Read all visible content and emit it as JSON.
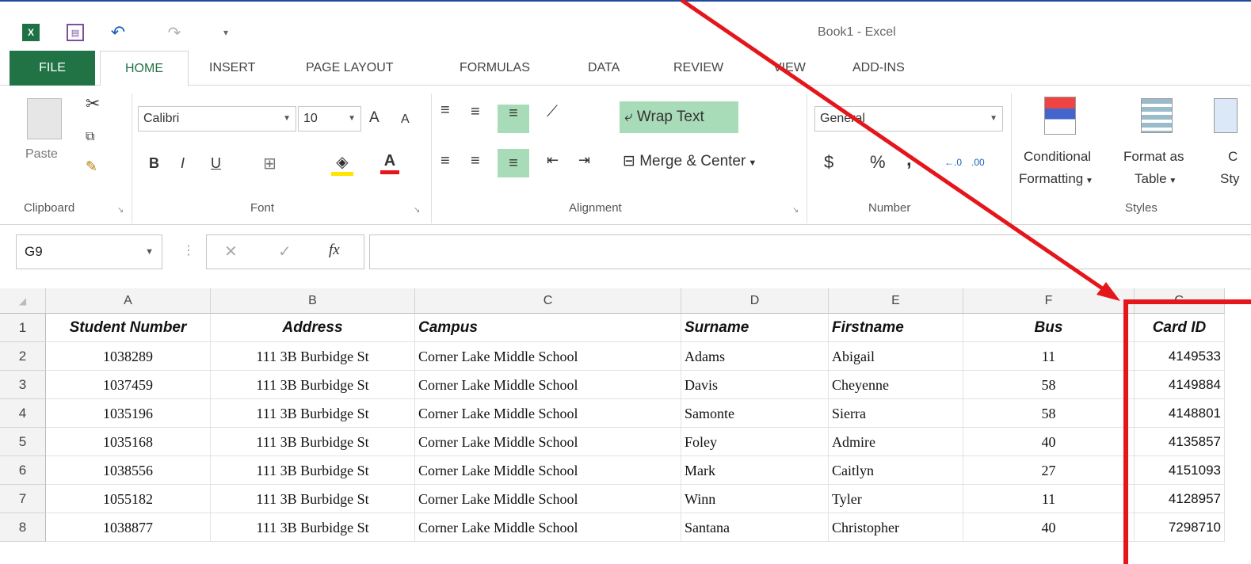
{
  "window": {
    "title": "Book1 - Excel"
  },
  "qat": {
    "logo": "X",
    "undo": "↶",
    "redo": "↷",
    "more": "▾"
  },
  "tabs": [
    "FILE",
    "HOME",
    "INSERT",
    "PAGE LAYOUT",
    "FORMULAS",
    "DATA",
    "REVIEW",
    "VIEW",
    "ADD-INS"
  ],
  "ribbon": {
    "clipboard": {
      "paste": "Paste",
      "label": "Clipboard"
    },
    "font": {
      "name": "Calibri",
      "size": "10",
      "bold": "B",
      "italic": "I",
      "underline": "U",
      "grow": "A",
      "shrink": "A",
      "fontcolor": "A",
      "label": "Font"
    },
    "alignment": {
      "wrap": "Wrap Text",
      "merge": "Merge & Center",
      "label": "Alignment"
    },
    "number": {
      "format": "General",
      "currency": "$",
      "percent": "%",
      "comma": ",",
      "label": "Number",
      "inc_dec": "←.0",
      "dec_dec": ".00"
    },
    "styles": {
      "cond1": "Conditional",
      "cond2": "Formatting",
      "fmt1": "Format as",
      "fmt2": "Table",
      "cell1": "C",
      "cell2": "Sty",
      "label": "Styles"
    }
  },
  "formula_bar": {
    "name_box": "G9",
    "fx": "fx",
    "cancel": "✕",
    "enter": "✓",
    "value": ""
  },
  "columns": [
    "A",
    "B",
    "C",
    "D",
    "E",
    "F",
    "G"
  ],
  "rows": [
    {
      "n": "1",
      "A": "Student Number",
      "B": "Address",
      "C": "Campus",
      "D": "Surname",
      "E": "Firstname",
      "F": "Bus",
      "G": "Card ID"
    },
    {
      "n": "2",
      "A": "1038289",
      "B": "111 3B Burbidge St",
      "C": "Corner Lake Middle School",
      "D": "Adams",
      "E": "Abigail",
      "F": "11",
      "G": "4149533"
    },
    {
      "n": "3",
      "A": "1037459",
      "B": "111 3B Burbidge St",
      "C": "Corner Lake Middle School",
      "D": "Davis",
      "E": "Cheyenne",
      "F": "58",
      "G": "4149884"
    },
    {
      "n": "4",
      "A": "1035196",
      "B": "111 3B Burbidge St",
      "C": "Corner Lake Middle School",
      "D": "Samonte",
      "E": "Sierra",
      "F": "58",
      "G": "4148801"
    },
    {
      "n": "5",
      "A": "1035168",
      "B": "111 3B Burbidge St",
      "C": "Corner Lake Middle School",
      "D": "Foley",
      "E": "Admire",
      "F": "40",
      "G": "4135857"
    },
    {
      "n": "6",
      "A": "1038556",
      "B": "111 3B Burbidge St",
      "C": "Corner Lake Middle School",
      "D": "Mark",
      "E": "Caitlyn",
      "F": "27",
      "G": "4151093"
    },
    {
      "n": "7",
      "A": "1055182",
      "B": "111 3B Burbidge St",
      "C": "Corner Lake Middle School",
      "D": "Winn",
      "E": "Tyler",
      "F": "11",
      "G": "4128957"
    },
    {
      "n": "8",
      "A": "1038877",
      "B": "111 3B Burbidge St",
      "C": "Corner Lake Middle School",
      "D": "Santana",
      "E": "Christopher",
      "F": "40",
      "G": "7298710"
    }
  ],
  "colors": {
    "excel_green": "#217346",
    "annotation_red": "#e5161b"
  }
}
